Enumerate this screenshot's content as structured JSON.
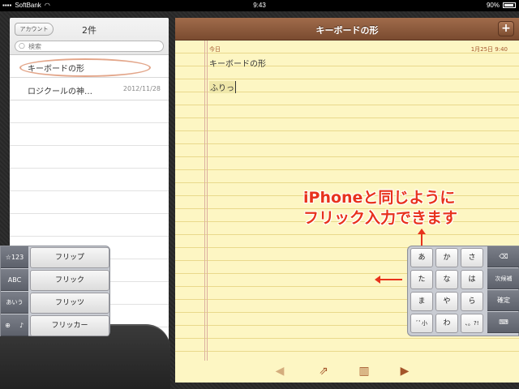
{
  "statusbar": {
    "carrier": "SoftBank",
    "time": "9:43",
    "battery": "90%"
  },
  "list": {
    "account_label": "アカウント",
    "count": "2件",
    "search_placeholder": "検索",
    "notes": [
      {
        "title": "キーボードの形",
        "date": ""
      },
      {
        "title": "ロジクールの神…",
        "date": "2012/11/28"
      }
    ]
  },
  "note": {
    "header_title": "キーボードの形",
    "add_label": "+",
    "today": "今日",
    "date": "1月25日 9:40",
    "line1": "キーボードの形",
    "line2": "ふりっ"
  },
  "callout": {
    "line1": "iPhoneと同じように",
    "line2": "フリック入力できます"
  },
  "left_keyboard": {
    "mode_keys": [
      "☆123",
      "ABC",
      "あいう"
    ],
    "candidates": [
      "フリップ",
      "フリック",
      "フリッツ",
      "フリッカー"
    ]
  },
  "right_keyboard": {
    "rows": [
      [
        "あ",
        "か",
        "さ"
      ],
      [
        "た",
        "な",
        "は"
      ],
      [
        "ま",
        "や",
        "ら"
      ],
      [
        "ﾞﾟ小",
        "わ",
        "、。?!"
      ]
    ],
    "function_keys": [
      "⌫",
      "次候補",
      "確定",
      "⌨"
    ]
  },
  "colors": {
    "accent_red": "#e8321c",
    "header_brown": "#7a4b30",
    "paper_yellow": "#fdf6c3"
  }
}
